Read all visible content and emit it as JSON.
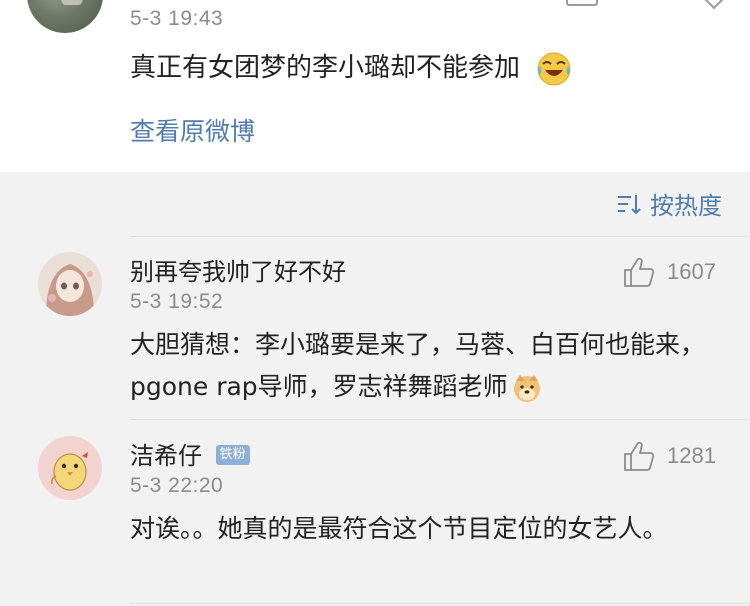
{
  "post": {
    "time": "5-3 19:43",
    "text": "真正有女团梦的李小璐却不能参加",
    "emoji": "laugh-cry-emoji",
    "view_original": "查看原微博"
  },
  "sort": {
    "label": "按热度",
    "icon": "sort-icon"
  },
  "comments": [
    {
      "username": "别再夸我帅了好不好",
      "time": "5-3 19:52",
      "likes": "1607",
      "text": "大胆猜想：李小璐要是来了，马蓉、白百何也能来，pgone rap导师，罗志祥舞蹈老师",
      "emoji": "doge-emoji",
      "badge": ""
    },
    {
      "username": "洁希仔",
      "time": "5-3 22:20",
      "likes": "1281",
      "text": "对诶。。她真的是最符合这个节目定位的女艺人。",
      "badge": "铁粉"
    }
  ],
  "colors": {
    "link": "#507daf",
    "muted": "#8c8c8c",
    "badge": "#8fb0d6",
    "background": "#f2f2f2"
  }
}
